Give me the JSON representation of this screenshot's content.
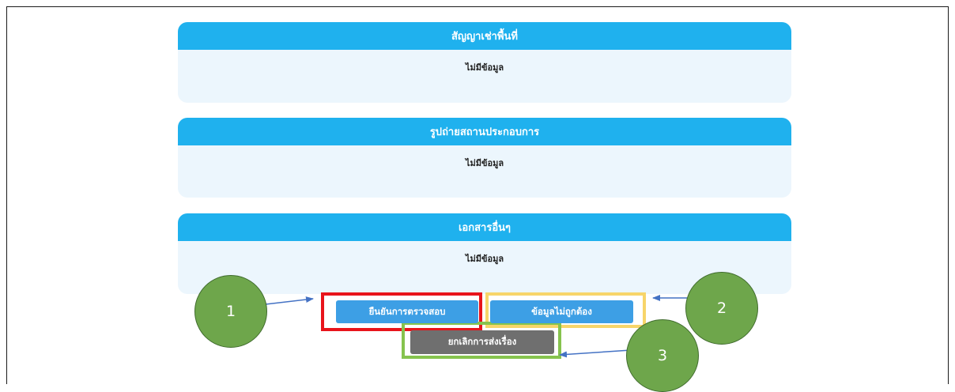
{
  "sections": [
    {
      "title": "สัญญาเช่าพื้นที่",
      "body": "ไม่มีข้อมูล"
    },
    {
      "title": "รูปถ่ายสถานประกอบการ",
      "body": "ไม่มีข้อมูล"
    },
    {
      "title": "เอกสารอื่นๆ",
      "body": "ไม่มีข้อมูล"
    }
  ],
  "actions": {
    "confirm_label": "ยืนยันการตรวจสอบ",
    "incorrect_label": "ข้อมูลไม่ถูกต้อง",
    "cancel_label": "ยกเลิกการส่งเรื่อง"
  },
  "annotations": {
    "marker_1": "1",
    "marker_2": "2",
    "marker_3": "3"
  },
  "colors": {
    "header_bg": "#1fb1ee",
    "panel_bg": "#ecf6fd",
    "button_blue": "#3d9fe5",
    "button_gray": "#6f6f6f",
    "highlight_red": "#e8141b",
    "highlight_yellow": "#f7d56a",
    "highlight_green": "#86c34e",
    "marker_green": "#6ea64b"
  }
}
